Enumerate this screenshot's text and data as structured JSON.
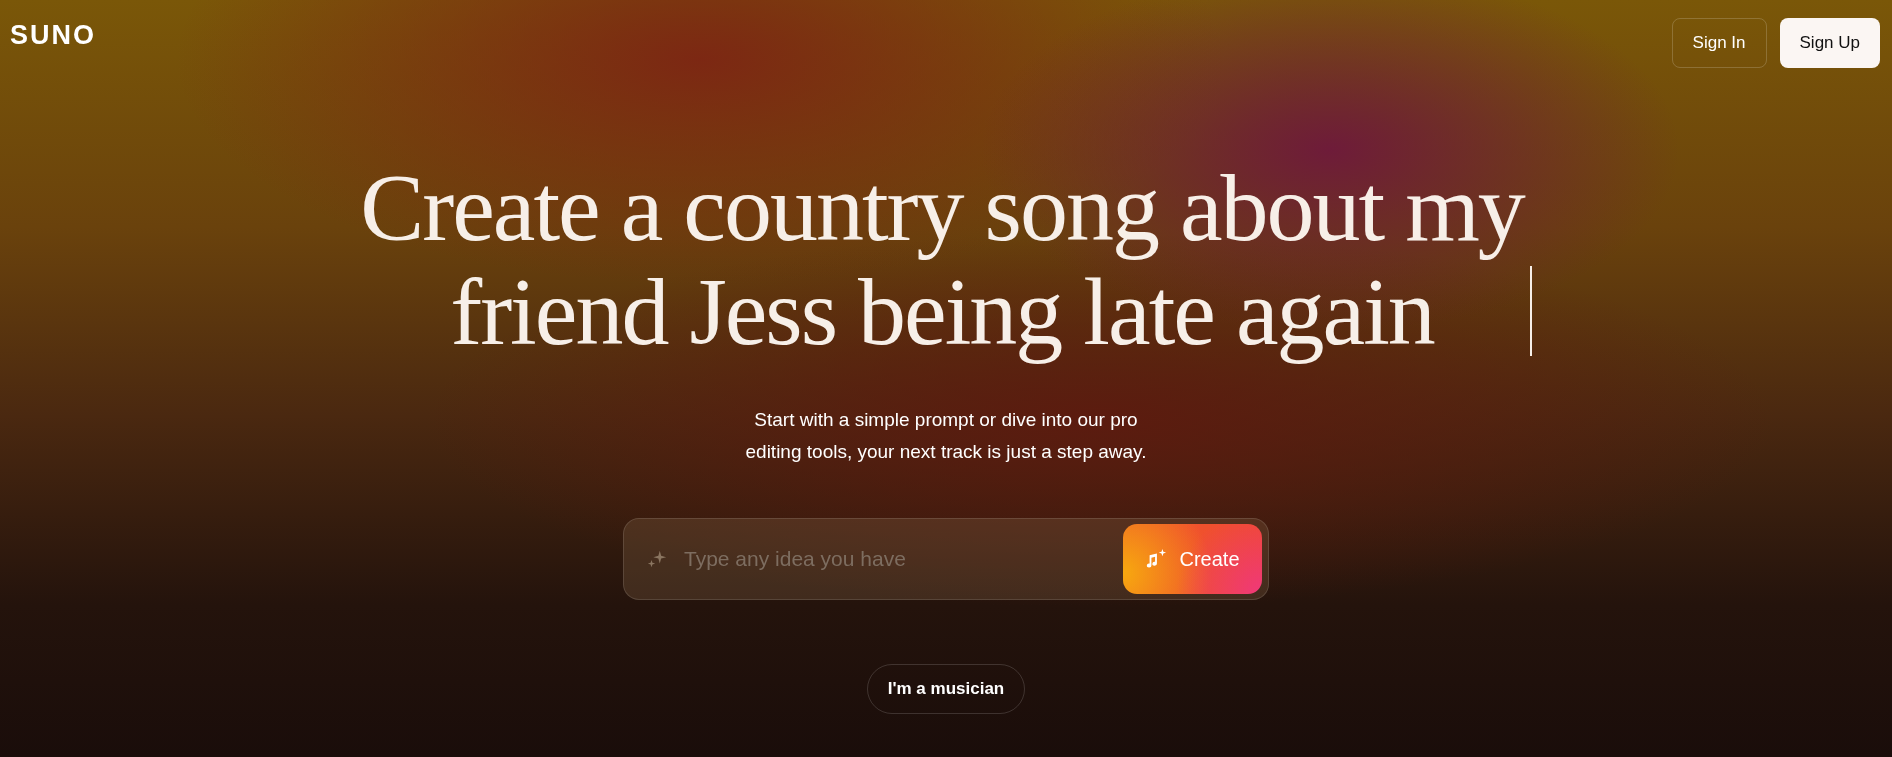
{
  "header": {
    "logo": "SUNO",
    "buttons": [
      {
        "label": "Sign In",
        "kind": "outline"
      },
      {
        "label": "Sign Up",
        "kind": "solid"
      }
    ]
  },
  "hero": {
    "headline": "Create a country song about my\nfriend Jess being late again",
    "subtitle": "Start with a simple prompt or dive into our pro\nediting tools, your next track is just a step away.",
    "prompt": {
      "placeholder": "Type any idea you have",
      "button": "Create"
    },
    "secondary_button": "I'm a musician"
  }
}
